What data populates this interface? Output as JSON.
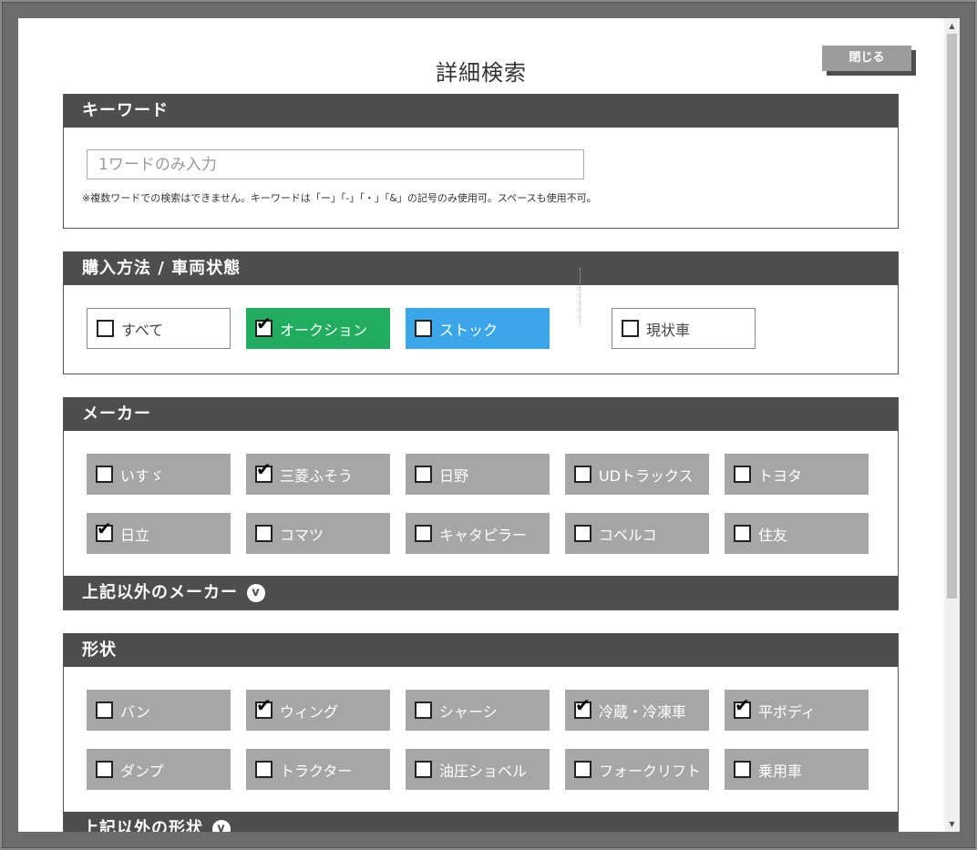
{
  "dialog": {
    "title": "詳細検索",
    "close_label": "閉じる"
  },
  "keyword": {
    "header": "キーワード",
    "placeholder": "1ワードのみ入力",
    "value": "",
    "note": "※複数ワードでの検索はできません。キーワードは「ー」「-」「・」「&」の記号のみ使用可。スペースも使用不可。"
  },
  "purchase": {
    "header": "購入方法 / 車両状態",
    "options": [
      {
        "label": "すべて",
        "checked": false
      },
      {
        "label": "オークション",
        "checked": true
      },
      {
        "label": "ストック",
        "checked": false
      },
      {
        "label": "現状車",
        "checked": false
      }
    ]
  },
  "maker": {
    "header": "メーカー",
    "options": [
      {
        "label": "いすゞ",
        "checked": false
      },
      {
        "label": "三菱ふそう",
        "checked": true
      },
      {
        "label": "日野",
        "checked": false
      },
      {
        "label": "UDトラックス",
        "checked": false
      },
      {
        "label": "トヨタ",
        "checked": false
      },
      {
        "label": "日立",
        "checked": true
      },
      {
        "label": "コマツ",
        "checked": false
      },
      {
        "label": "キャタピラー",
        "checked": false
      },
      {
        "label": "コベルコ",
        "checked": false
      },
      {
        "label": "住友",
        "checked": false
      }
    ],
    "other_label": "上記以外のメーカー",
    "chevron": "chevron-down-circle-icon"
  },
  "shape": {
    "header": "形状",
    "options": [
      {
        "label": "バン",
        "checked": false
      },
      {
        "label": "ウィング",
        "checked": true
      },
      {
        "label": "シャーシ",
        "checked": false
      },
      {
        "label": "冷蔵・冷凍車",
        "checked": true
      },
      {
        "label": "平ボディ",
        "checked": true
      },
      {
        "label": "ダンプ",
        "checked": false
      },
      {
        "label": "トラクター",
        "checked": false
      },
      {
        "label": "油圧ショベル",
        "checked": false
      },
      {
        "label": "フォークリフト",
        "checked": false
      },
      {
        "label": "乗用車",
        "checked": false
      }
    ],
    "other_label": "上記以外の形状"
  },
  "colors": {
    "header_bg": "#4e4e4e",
    "option_gray": "#a6a6a6",
    "auction_green": "#22ac5f",
    "stock_blue": "#3ba6ea"
  }
}
